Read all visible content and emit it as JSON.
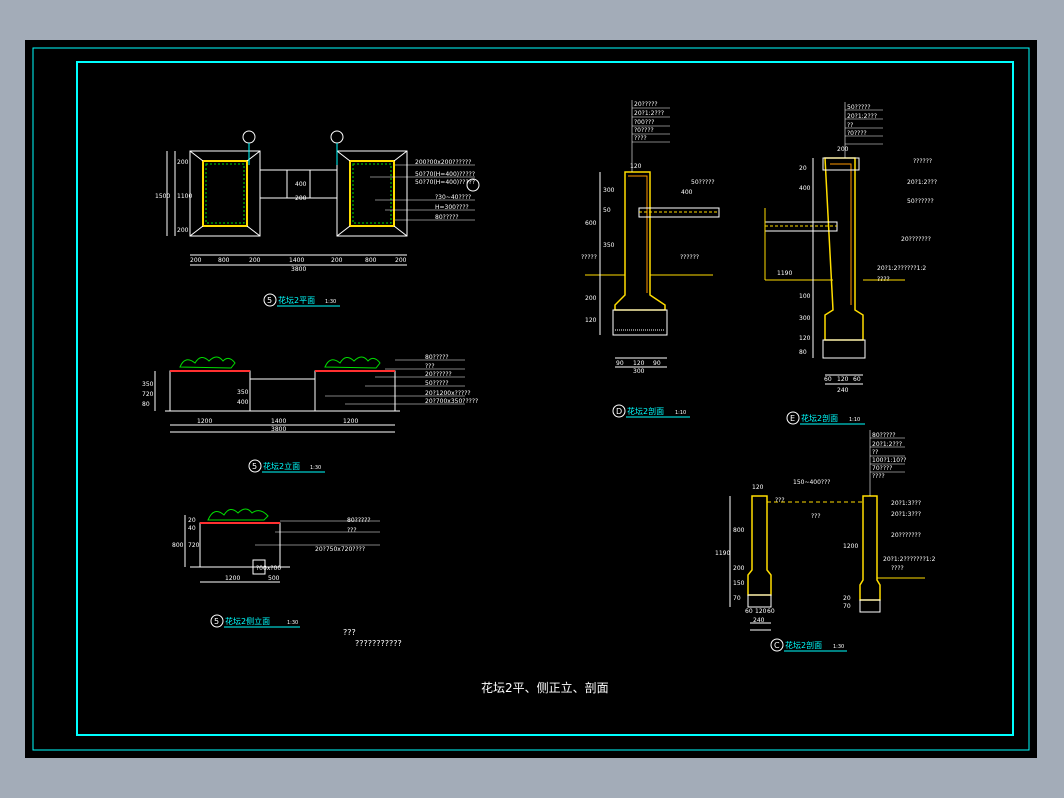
{
  "sheet_title": "花坛2平、侧正立、剖面",
  "views": {
    "plan": {
      "number": "5",
      "title": "花坛2平面",
      "scale": "1:30"
    },
    "elevation": {
      "number": "5",
      "title": "花坛2立面",
      "scale": "1:30"
    },
    "side": {
      "number": "5",
      "title": "花坛2侧立面",
      "scale": "1:30"
    },
    "section_d": {
      "number": "D",
      "title": "花坛2剖面",
      "scale": "1:10"
    },
    "section_e": {
      "number": "E",
      "title": "花坛2剖面",
      "scale": "1:10"
    },
    "section_c": {
      "number": "C",
      "title": "花坛2剖面",
      "scale": "1:30"
    }
  },
  "notes": [
    "???",
    "???????????"
  ],
  "plan_dims": {
    "bottom": [
      "200",
      "800",
      "200",
      "1400",
      "200",
      "800",
      "200"
    ],
    "total": "3800",
    "left": [
      "200",
      "1100",
      "200"
    ],
    "left_total": "1500",
    "mid": [
      "400",
      "200"
    ]
  },
  "plan_callouts": [
    "200?00x200??????",
    "50?70(H=400)?????",
    "50?70(H=400)?????",
    "?30~40????",
    "H=300????",
    "80?????"
  ],
  "elev_callouts": [
    "80?????",
    "???",
    "20??????",
    "50?????",
    "20?1200x?????",
    "20?700x350?????"
  ],
  "elev_dims": {
    "bottom": [
      "1200",
      "1400",
      "1200"
    ],
    "total": "3800",
    "left": [
      "350",
      "720",
      "80"
    ],
    "mid": [
      "350",
      "400"
    ]
  },
  "side_callouts": [
    "80?????",
    "???",
    "20?750x720????"
  ],
  "side_dims": {
    "bottom": [
      "1200"
    ],
    "step": "500",
    "left": [
      "20",
      "40",
      "720",
      "800"
    ],
    "step_h": "?00x?00"
  },
  "sd_callouts": [
    "20?????",
    "20?1:2???",
    "?00???",
    "?0????",
    "????"
  ],
  "sd_labels": [
    "50?????",
    "400",
    "?????",
    "??????"
  ],
  "sd_dims": {
    "top": "120",
    "bottom": [
      "90",
      "120",
      "90"
    ],
    "total": "300",
    "left": [
      "600",
      "350",
      "200",
      "120",
      "300",
      "50"
    ]
  },
  "se_callouts": [
    "50?????",
    "20?1:2???",
    "??",
    "?0????",
    "200"
  ],
  "se_labels": [
    "??????",
    "20?1:2???",
    "50??????",
    "20???????",
    "20?1:2??????1:2",
    "????"
  ],
  "se_dims": {
    "bottom": [
      "60",
      "120",
      "60"
    ],
    "total": "240",
    "left": [
      "20",
      "400",
      "1190",
      "100",
      "300",
      "120",
      "80"
    ]
  },
  "sc_callouts": [
    "80?????",
    "20?1:2???",
    "??",
    "100?1:10??",
    "70????",
    "????"
  ],
  "sc_labels": [
    "150~400???",
    "???",
    "???",
    "20?1:3???",
    "20?1:3???",
    "20???????",
    "20?1:2???????1:2",
    "????"
  ],
  "sc_dims": {
    "top": "120",
    "bottom": [
      "60",
      "120",
      "60"
    ],
    "total": "240",
    "left": [
      "1190",
      "800",
      "200",
      "150",
      "70"
    ],
    "right": [
      "1200",
      "20",
      "70"
    ]
  }
}
